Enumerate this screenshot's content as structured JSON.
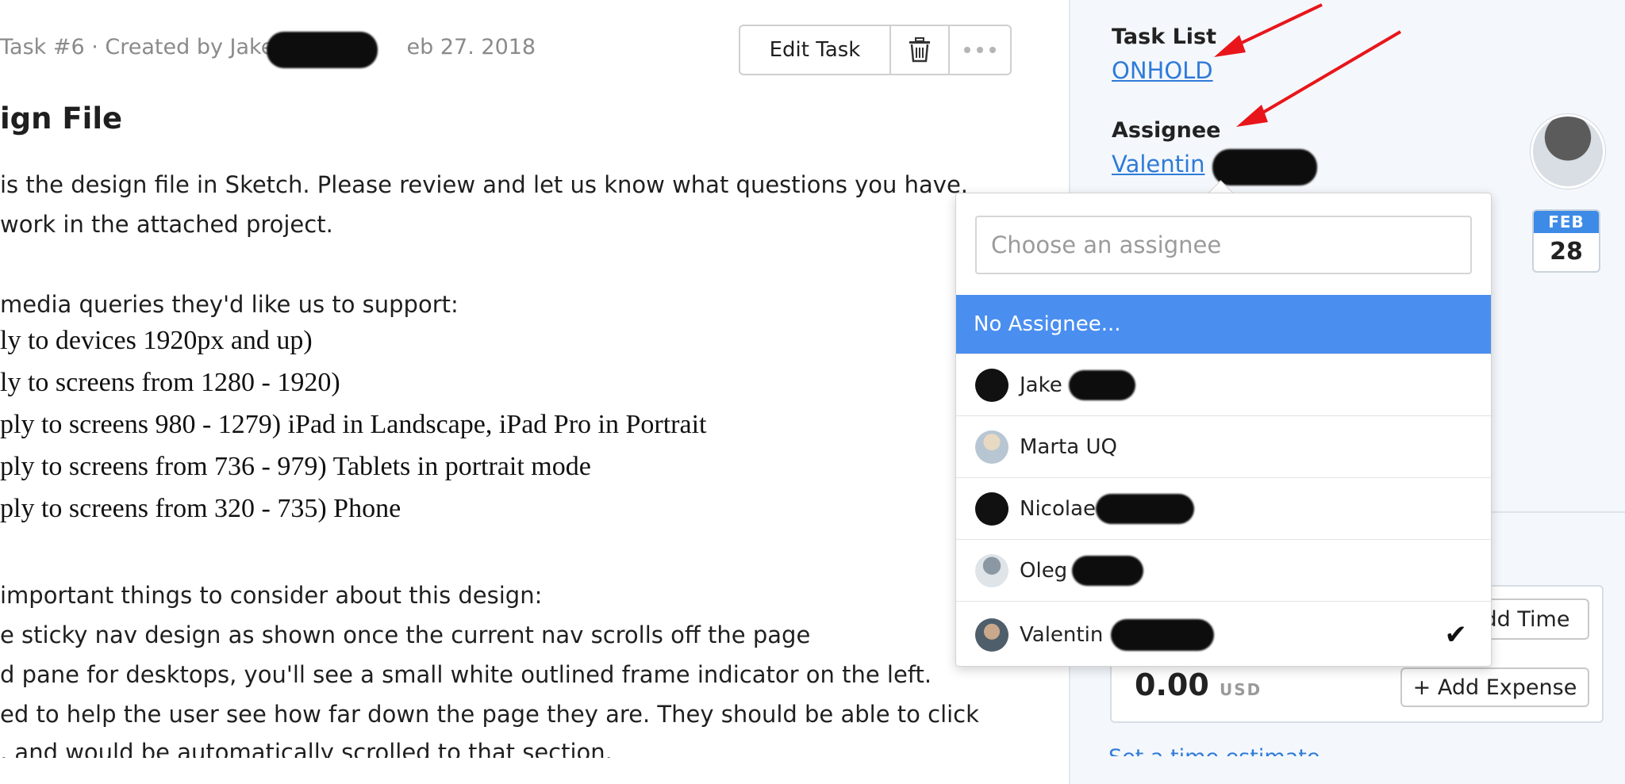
{
  "task_header": {
    "meta_prefix": "Task #6 · Created by Jake",
    "meta_date": "eb 27. 2018",
    "edit_label": "Edit Task",
    "title": "ign File"
  },
  "description": {
    "p1_line1": "is the design file in Sketch.  Please review and let us know what questions you have.",
    "p1_line2": "work in the attached project.",
    "mq_intro": "media queries they'd like us to support:",
    "mq": [
      "ly to devices 1920px and up)",
      "ly to screens from 1280 - 1920)",
      "ply to screens 980 - 1279) iPad in Landscape, iPad Pro in Portrait",
      "ply to screens from 736 - 979) Tablets in portrait mode",
      "ply to screens from 320 - 735) Phone"
    ],
    "consider_intro": "important things to consider about this design:",
    "consider": [
      "e sticky nav design as shown once the current nav scrolls off the page",
      "d pane for desktops, you'll see a small white outlined frame indicator on the left.",
      "ed to help the user see how far down the page they are.  They should be able to click",
      ", and would be automatically scrolled to that section."
    ]
  },
  "sidebar": {
    "task_list_label": "Task List",
    "task_list_value": "ONHOLD",
    "assignee_label": "Assignee",
    "assignee_value": "Valentin",
    "due_month": "FEB",
    "due_day": "28",
    "add_time_label": "dd Time",
    "amount": "0.00",
    "currency": "USD",
    "add_expense_label": "+ Add Expense",
    "bottom_link": "Set a time estimate"
  },
  "assignee_dropdown": {
    "placeholder": "Choose an assignee",
    "no_assignee": "No Assignee...",
    "people": [
      {
        "name": "Jake",
        "avatar_color": "#111111",
        "selected": false
      },
      {
        "name": "Marta UQ",
        "avatar_color": "#c9b9a3",
        "selected": false
      },
      {
        "name": "Nicolae",
        "avatar_color": "#111111",
        "selected": false
      },
      {
        "name": "Oleg",
        "avatar_color": "#9aa4ae",
        "selected": false
      },
      {
        "name": "Valentin",
        "avatar_color": "#6b7b88",
        "selected": true
      }
    ],
    "check_mark": "✔"
  },
  "colors": {
    "accent": "#4a8ef0",
    "link": "#2f7bd8",
    "annotation_arrow": "#e8161b"
  }
}
